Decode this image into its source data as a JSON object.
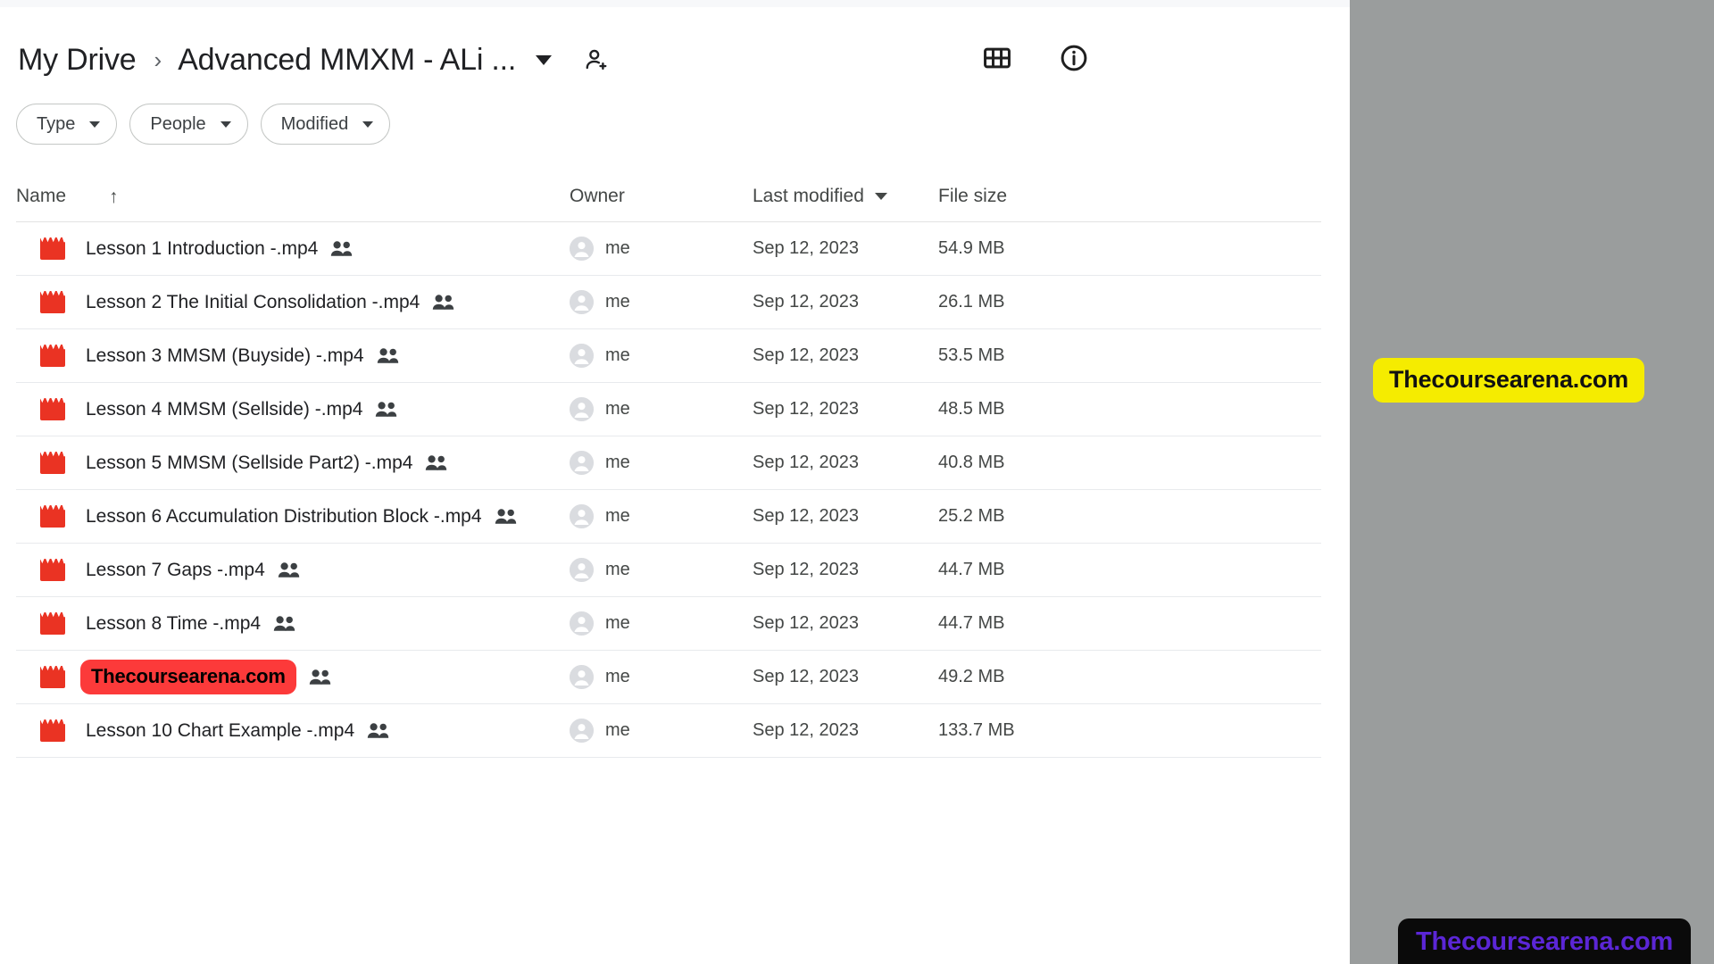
{
  "window": {
    "app": "Google Drive",
    "background_color": "#ffffff",
    "overlay_panel_color": "#9a9d9d"
  },
  "breadcrumb": {
    "root_label": "My Drive",
    "separator": "›",
    "current_label": "Advanced MMXM - ALi ...",
    "caret_icon": "chevron-down-icon",
    "shared_icon": "person-shared-icon"
  },
  "header_actions": [
    {
      "icon": "grid-view-icon",
      "label": "Grid view"
    },
    {
      "icon": "info-circle-icon",
      "label": "View details"
    }
  ],
  "filters": [
    {
      "label": "Type",
      "caret": "chevron-down-icon"
    },
    {
      "label": "People",
      "caret": "chevron-down-icon"
    },
    {
      "label": "Modified",
      "caret": "chevron-down-icon"
    }
  ],
  "table": {
    "columns": [
      {
        "key": "name",
        "label": "Name",
        "sort_indicator": "↑"
      },
      {
        "key": "owner",
        "label": "Owner",
        "sort_indicator": ""
      },
      {
        "key": "modified",
        "label": "Last modified",
        "sort_indicator": "caret-down"
      },
      {
        "key": "size",
        "label": "File size",
        "sort_indicator": ""
      }
    ],
    "rows": [
      {
        "icon": "video-file-icon",
        "name": "Lesson 1 Introduction  -.mp4",
        "shared_icon": "people-shared-icon",
        "owner": "me",
        "owner_avatar": "person-avatar-icon",
        "modified": "Sep 12, 2023",
        "size": "54.9 MB",
        "watermarked": false
      },
      {
        "icon": "video-file-icon",
        "name": "Lesson 2 The Initial Consolidation -.mp4",
        "shared_icon": "people-shared-icon",
        "owner": "me",
        "owner_avatar": "person-avatar-icon",
        "modified": "Sep 12, 2023",
        "size": "26.1 MB",
        "watermarked": false
      },
      {
        "icon": "video-file-icon",
        "name": "Lesson 3 MMSM (Buyside) -.mp4",
        "shared_icon": "people-shared-icon",
        "owner": "me",
        "owner_avatar": "person-avatar-icon",
        "modified": "Sep 12, 2023",
        "size": "53.5 MB",
        "watermarked": false
      },
      {
        "icon": "video-file-icon",
        "name": "Lesson 4 MMSM (Sellside) -.mp4",
        "shared_icon": "people-shared-icon",
        "owner": "me",
        "owner_avatar": "person-avatar-icon",
        "modified": "Sep 12, 2023",
        "size": "48.5 MB",
        "watermarked": false
      },
      {
        "icon": "video-file-icon",
        "name": "Lesson 5 MMSM (Sellside Part2) -.mp4",
        "shared_icon": "people-shared-icon",
        "owner": "me",
        "owner_avatar": "person-avatar-icon",
        "modified": "Sep 12, 2023",
        "size": "40.8 MB",
        "watermarked": false
      },
      {
        "icon": "video-file-icon",
        "name": "Lesson 6 Accumulation Distribution Block -.mp4",
        "shared_icon": "people-shared-icon",
        "owner": "me",
        "owner_avatar": "person-avatar-icon",
        "modified": "Sep 12, 2023",
        "size": "25.2 MB",
        "watermarked": false
      },
      {
        "icon": "video-file-icon",
        "name": "Lesson 7 Gaps -.mp4",
        "shared_icon": "people-shared-icon",
        "owner": "me",
        "owner_avatar": "person-avatar-icon",
        "modified": "Sep 12, 2023",
        "size": "44.7 MB",
        "watermarked": false
      },
      {
        "icon": "video-file-icon",
        "name": "Lesson 8 Time -.mp4",
        "shared_icon": "people-shared-icon",
        "owner": "me",
        "owner_avatar": "person-avatar-icon",
        "modified": "Sep 12, 2023",
        "size": "44.7 MB",
        "watermarked": false
      },
      {
        "icon": "video-file-icon",
        "name": "Thecoursearena.com",
        "shared_icon": "people-shared-icon",
        "owner": "me",
        "owner_avatar": "person-avatar-icon",
        "modified": "Sep 12, 2023",
        "size": "49.2 MB",
        "watermarked": true
      },
      {
        "icon": "video-file-icon",
        "name": "Lesson 10 Chart Example -.mp4",
        "shared_icon": "people-shared-icon",
        "owner": "me",
        "owner_avatar": "person-avatar-icon",
        "modified": "Sep 12, 2023",
        "size": "133.7 MB",
        "watermarked": false
      }
    ]
  },
  "watermarks": {
    "row_badge": {
      "text": "Thecoursearena.com",
      "background": "#fc3a3a",
      "color": "#000000"
    },
    "side_badge": {
      "text": "Thecoursearena.com",
      "background": "#f5ec00",
      "color": "#111111"
    },
    "corner_badge": {
      "text": "Thecoursearena.com",
      "background": "#0a0a0a",
      "color": "#5b26d6"
    }
  }
}
